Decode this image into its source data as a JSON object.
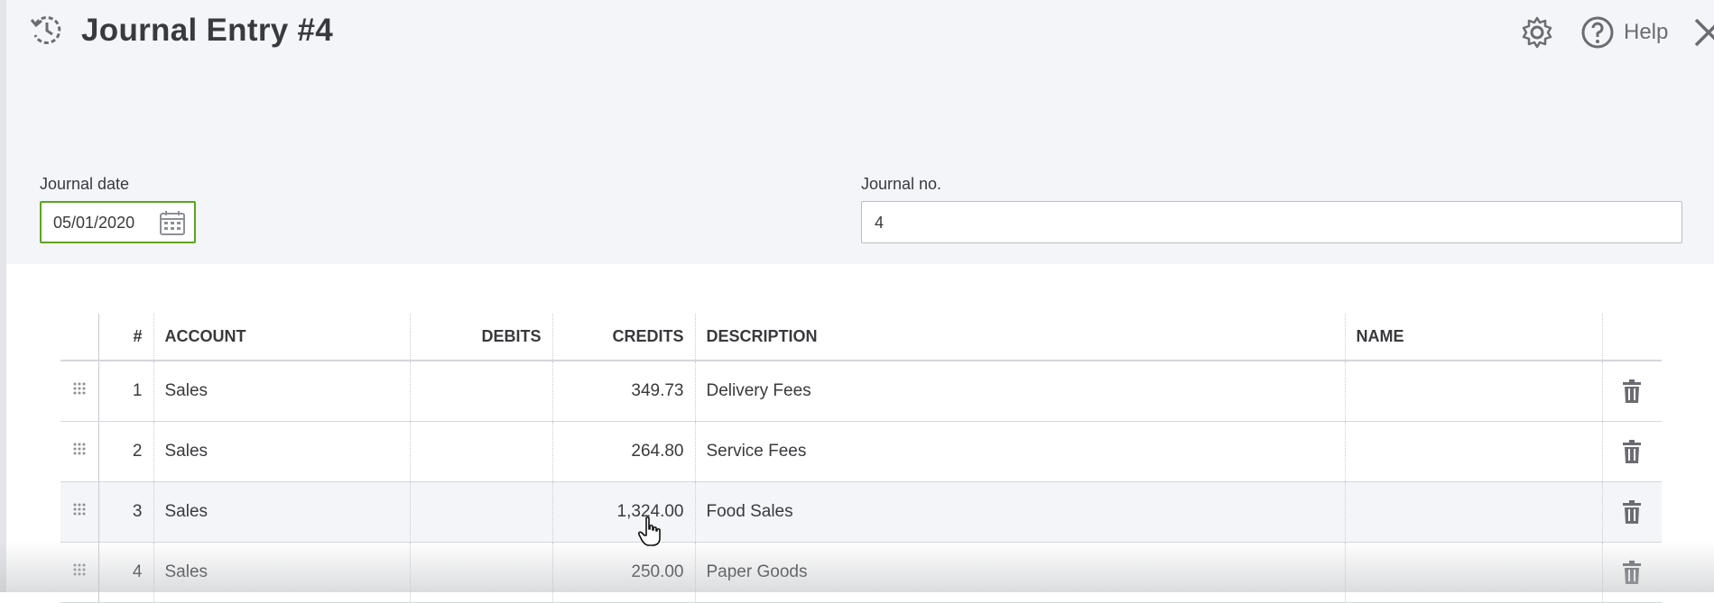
{
  "header": {
    "title": "Journal Entry #4",
    "help_label": "Help",
    "icons": [
      "history-icon",
      "gear-icon",
      "help-icon",
      "close-icon"
    ]
  },
  "form": {
    "journal_date_label": "Journal date",
    "journal_date_value": "05/01/2020",
    "journal_no_label": "Journal no.",
    "journal_no_value": "4"
  },
  "table": {
    "columns": [
      "#",
      "ACCOUNT",
      "DEBITS",
      "CREDITS",
      "DESCRIPTION",
      "NAME"
    ],
    "rows": [
      {
        "num": "1",
        "account": "Sales",
        "debits": "",
        "credits": "349.73",
        "description": "Delivery Fees",
        "name": ""
      },
      {
        "num": "2",
        "account": "Sales",
        "debits": "",
        "credits": "264.80",
        "description": "Service Fees",
        "name": ""
      },
      {
        "num": "3",
        "account": "Sales",
        "debits": "",
        "credits": "1,324.00",
        "description": "Food Sales",
        "name": ""
      },
      {
        "num": "4",
        "account": "Sales",
        "debits": "",
        "credits": "250.00",
        "description": "Paper Goods",
        "name": ""
      }
    ]
  },
  "colors": {
    "header_bg": "#f4f5f8",
    "date_border": "#5aa51e",
    "text": "#393a3d",
    "icon_gray": "#6b6c72"
  }
}
